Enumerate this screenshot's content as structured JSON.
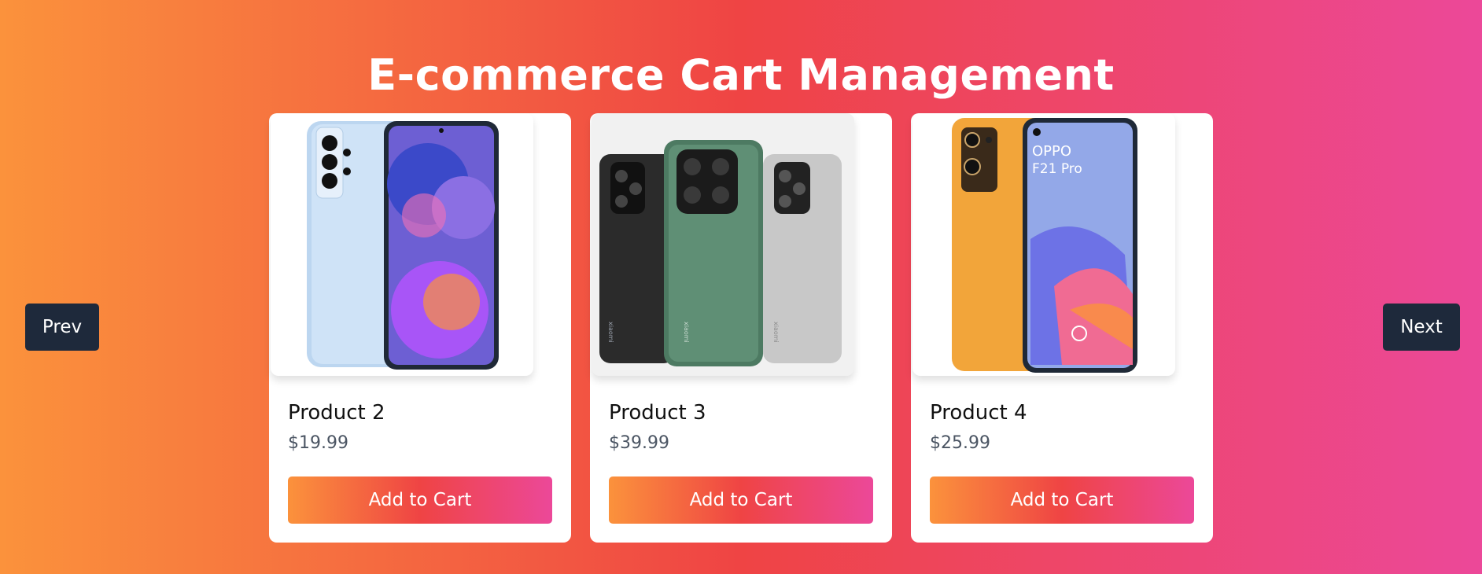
{
  "page": {
    "title": "E-commerce Cart Management"
  },
  "carousel": {
    "prev_label": "Prev",
    "next_label": "Next"
  },
  "products": [
    {
      "name": "Product 2",
      "price": "$19.99",
      "button_label": "Add to Cart",
      "image": "light-blue-samsung-phone"
    },
    {
      "name": "Product 3",
      "price": "$39.99",
      "button_label": "Add to Cart",
      "image": "three-xiaomi-phones",
      "image_text": [
        "xiaomi",
        "xiaomi",
        "xiaomi"
      ]
    },
    {
      "name": "Product 4",
      "price": "$25.99",
      "button_label": "Add to Cart",
      "image": "orange-oppo-phone",
      "image_text": [
        "OPPO",
        "F21 Pro"
      ]
    }
  ],
  "colors": {
    "gradient_start": "#fb923c",
    "gradient_mid": "#ef4444",
    "gradient_end": "#ec4899",
    "nav_button": "#1e293b"
  }
}
